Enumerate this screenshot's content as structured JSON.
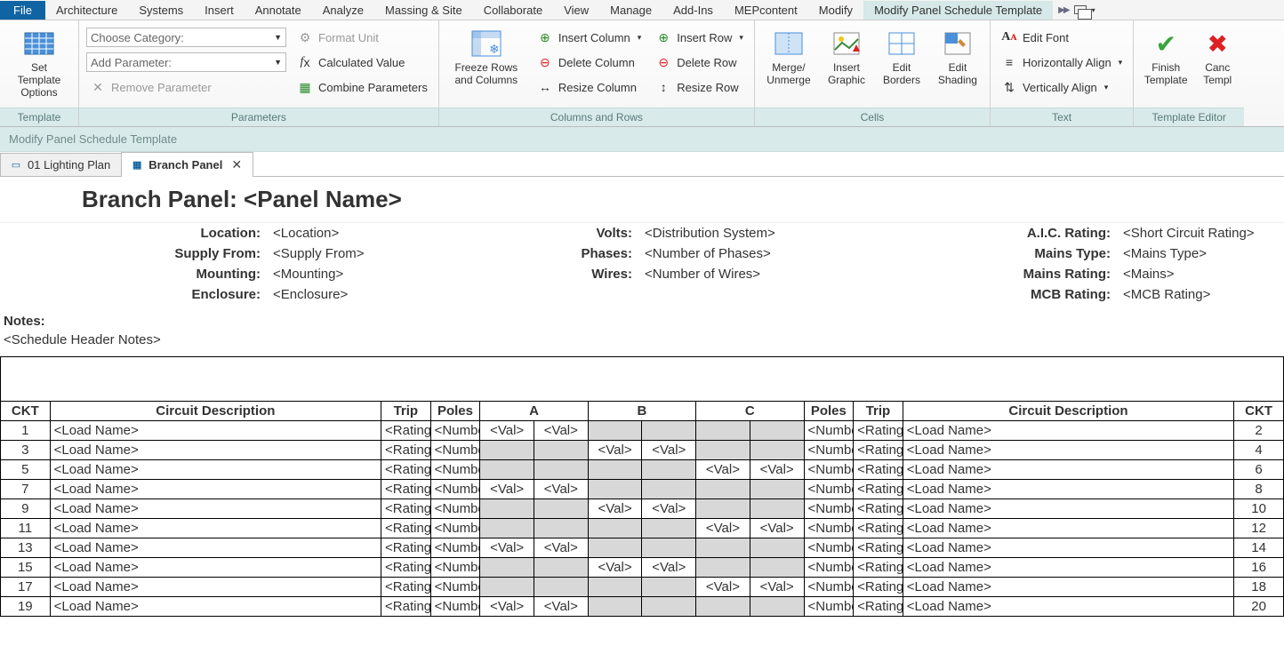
{
  "menu": {
    "file": "File",
    "items": [
      "Architecture",
      "Systems",
      "Insert",
      "Annotate",
      "Analyze",
      "Massing & Site",
      "Collaborate",
      "View",
      "Manage",
      "Add-Ins",
      "MEPcontent",
      "Modify"
    ],
    "active": "Modify Panel Schedule Template"
  },
  "ribbon": {
    "template": {
      "btn": "Set Template\nOptions",
      "label": "Template"
    },
    "parameters": {
      "combo1": "Choose Category:",
      "combo2": "Add Parameter:",
      "remove": "Remove Parameter",
      "format": "Format  Unit",
      "calc": "Calculated  Value",
      "combine": "Combine  Parameters",
      "label": "Parameters"
    },
    "colsrows": {
      "freeze": "Freeze Rows\nand Columns",
      "insCol": "Insert Column",
      "delCol": "Delete  Column",
      "resCol": "Resize  Column",
      "insRow": "Insert Row",
      "delRow": "Delete  Row",
      "resRow": "Resize  Row",
      "label": "Columns and Rows"
    },
    "cells": {
      "merge": "Merge/\nUnmerge",
      "graphic": "Insert\nGraphic",
      "borders": "Edit\nBorders",
      "shading": "Edit\nShading",
      "label": "Cells"
    },
    "text": {
      "font": "Edit  Font",
      "halign": "Horizontally  Align",
      "valign": "Vertically  Align",
      "label": "Text"
    },
    "editor": {
      "finish": "Finish\nTemplate",
      "cancel": "Canc\nTempl",
      "label": "Template Editor"
    }
  },
  "subheader": "Modify Panel Schedule Template",
  "tabs": {
    "t1": "01 Lighting Plan",
    "t2": "Branch Panel"
  },
  "panel": {
    "title": "Branch Panel: <Panel Name>",
    "labels": {
      "loc": "Location:",
      "supply": "Supply From:",
      "mount": "Mounting:",
      "encl": "Enclosure:",
      "volts": "Volts:",
      "phases": "Phases:",
      "wires": "Wires:",
      "aic": "A.I.C. Rating:",
      "mtype": "Mains Type:",
      "mrating": "Mains Rating:",
      "mcb": "MCB Rating:"
    },
    "vals": {
      "loc": "<Location>",
      "supply": "<Supply From>",
      "mount": "<Mounting>",
      "encl": "<Enclosure>",
      "volts": "<Distribution System>",
      "phases": "<Number of Phases>",
      "wires": "<Number of Wires>",
      "aic": "<Short Circuit Rating>",
      "mtype": "<Mains Type>",
      "mrating": "<Mains>",
      "mcb": "<MCB Rating>"
    },
    "notesLabel": "Notes:",
    "notesVal": "<Schedule Header Notes>",
    "cols": {
      "ckt": "CKT",
      "desc": "Circuit Description",
      "trip": "Trip",
      "poles": "Poles",
      "a": "A",
      "b": "B",
      "c": "C"
    },
    "cell": {
      "load": "<Load Name>",
      "rating": "<Rating>",
      "numbe": "<Number of Poles>",
      "val": "<Val>"
    },
    "rows": [
      1,
      3,
      5,
      7,
      9,
      11,
      13,
      15,
      17,
      19
    ]
  }
}
